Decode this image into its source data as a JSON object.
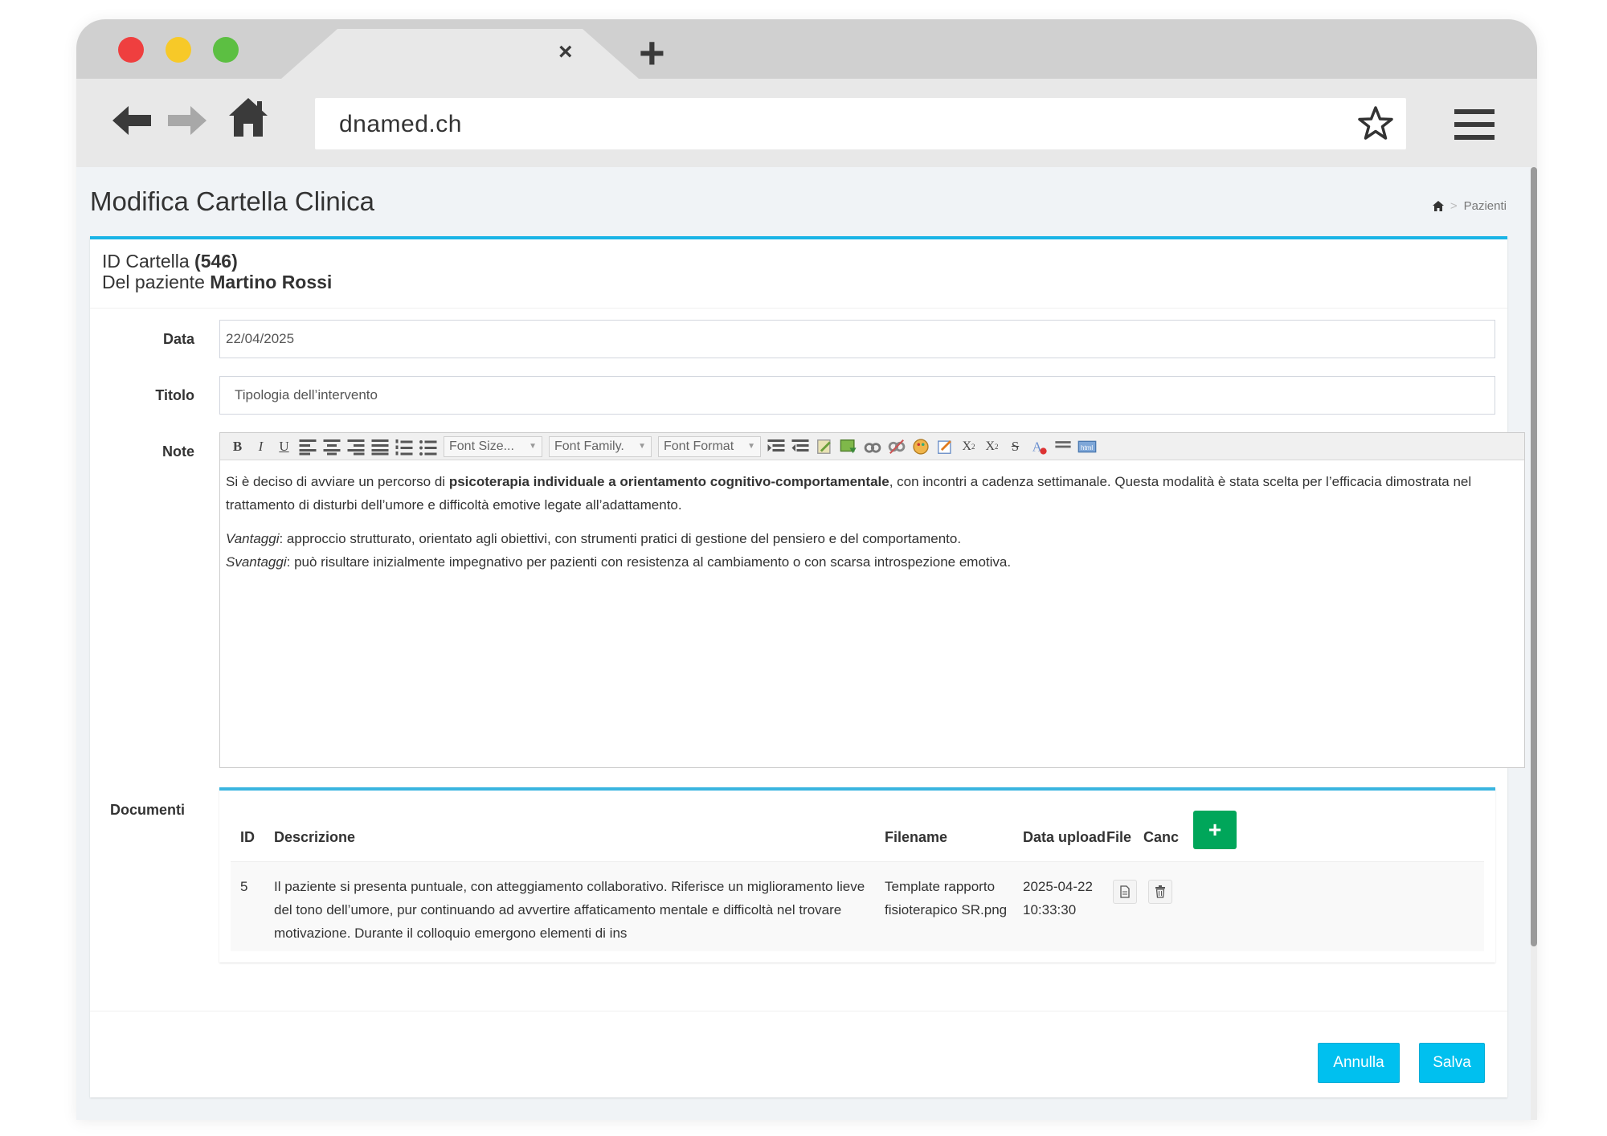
{
  "browser": {
    "tab_close": "×",
    "tab_new": "+",
    "url": "dnamed.ch"
  },
  "page": {
    "title": "Modifica Cartella Clinica",
    "breadcrumb": {
      "current": "Pazienti",
      "separator": ">"
    }
  },
  "record": {
    "id_label": "ID Cartella",
    "id_value": "(546)",
    "patient_label": "Del paziente",
    "patient_name": "Martino Rossi"
  },
  "form": {
    "data_label": "Data",
    "data_value": "22/04/2025",
    "titolo_label": "Titolo",
    "titolo_value": "Tipologia dell’intervento",
    "note_label": "Note",
    "documenti_label": "Documenti"
  },
  "editor": {
    "font_size": "Font Size...",
    "font_family": "Font Family.",
    "font_format": "Font Format",
    "p1_start": "Si è deciso di avviare un percorso di ",
    "p1_bold": "psicoterapia individuale a orientamento cognitivo-comportamentale",
    "p1_end": ", con incontri a cadenza settimanale. Questa modalità è stata scelta per l’efficacia dimostrata nel trattamento di disturbi dell’umore e difficoltà emotive legate all’adattamento.",
    "vantaggi_label": "Vantaggi",
    "vantaggi_text": ": approccio strutturato, orientato agli obiettivi, con strumenti pratici di gestione del pensiero e del comportamento.",
    "svantaggi_label": "Svantaggi",
    "svantaggi_text": ": può risultare inizialmente impegnativo per pazienti con resistenza al cambiamento o con scarsa introspezione emotiva."
  },
  "documents": {
    "headers": {
      "id": "ID",
      "descrizione": "Descrizione",
      "filename": "Filename",
      "data_upload": "Data upload",
      "file": "File",
      "canc": "Canc"
    },
    "add_label": "+",
    "rows": [
      {
        "id": "5",
        "descrizione": "Il paziente si presenta puntuale, con atteggiamento collaborativo. Riferisce un miglioramento lieve del tono dell’umore, pur continuando ad avvertire affaticamento mentale e difficoltà nel trovare motivazione. Durante il colloquio emergono elementi di ins",
        "filename": "Template rapporto fisioterapico SR.png",
        "date": "2025-04-22",
        "time": "10:33:30"
      }
    ]
  },
  "actions": {
    "cancel": "Annulla",
    "save": "Salva"
  },
  "colors": {
    "accent": "#1ab4e6",
    "button": "#00c0ef",
    "add_button": "#00a65a"
  }
}
